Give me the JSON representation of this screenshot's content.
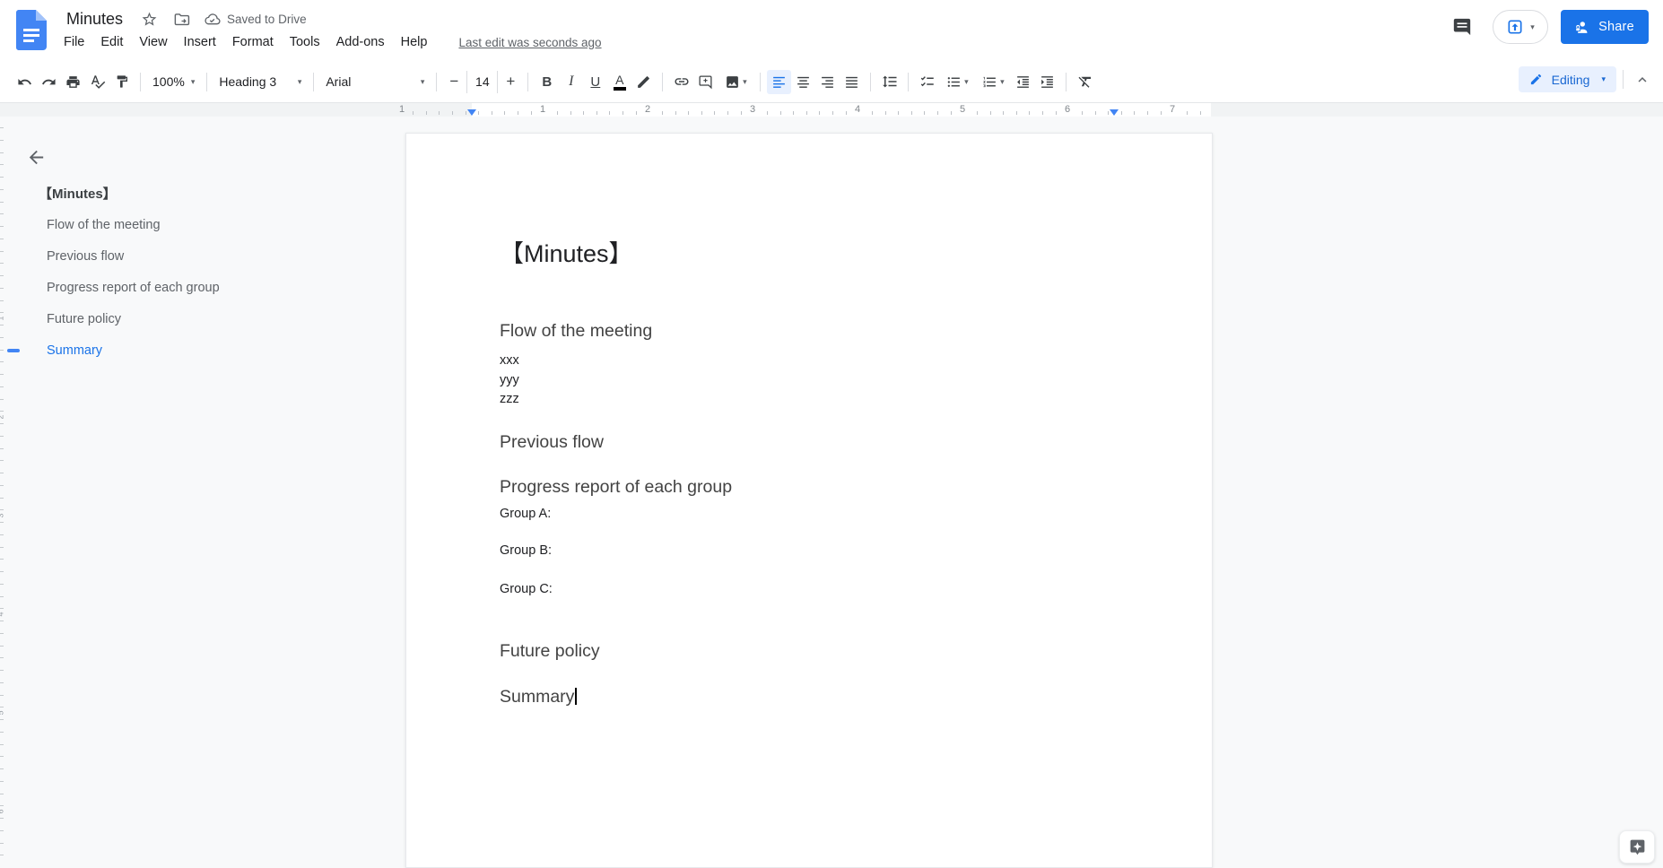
{
  "header": {
    "doc_title": "Minutes",
    "saved_status": "Saved to Drive",
    "last_edit": "Last edit was seconds ago",
    "menus": [
      "File",
      "Edit",
      "View",
      "Insert",
      "Format",
      "Tools",
      "Add-ons",
      "Help"
    ],
    "share_label": "Share"
  },
  "toolbar": {
    "zoom_value": "100%",
    "style_value": "Heading 3",
    "font_value": "Arial",
    "font_size_value": "14",
    "decrease_font_label": "−",
    "increase_font_label": "+",
    "bold_label": "B",
    "italic_label": "I",
    "underline_label": "U",
    "text_color_label": "A",
    "mode_label": "Editing"
  },
  "icons": {
    "dropdown": "▾"
  },
  "ruler": {
    "numbers": [
      "1",
      "1",
      "2",
      "3",
      "4",
      "5",
      "6",
      "7"
    ],
    "v_numbers": [
      "1",
      "2",
      "3",
      "4",
      "5",
      "6"
    ]
  },
  "outline": {
    "items": [
      {
        "label": "【Minutes】",
        "active": false
      },
      {
        "label": "Flow of the meeting",
        "active": false
      },
      {
        "label": "Previous flow",
        "active": false
      },
      {
        "label": "Progress report of each group",
        "active": false
      },
      {
        "label": "Future policy",
        "active": false
      },
      {
        "label": "Summary",
        "active": true
      }
    ]
  },
  "document": {
    "blocks": [
      {
        "type": "title",
        "text": "【Minutes】"
      },
      {
        "type": "heading",
        "text": "Flow of the meeting"
      },
      {
        "type": "body",
        "text": "xxx"
      },
      {
        "type": "body",
        "text": "yyy"
      },
      {
        "type": "body",
        "text": "zzz"
      },
      {
        "type": "heading",
        "text": "Previous flow"
      },
      {
        "type": "heading",
        "text": "Progress report of each group"
      },
      {
        "type": "body",
        "text": "Group A:"
      },
      {
        "type": "body",
        "text": "Group B:"
      },
      {
        "type": "body",
        "text": "Group C:"
      },
      {
        "type": "heading",
        "text": "Future policy"
      },
      {
        "type": "heading",
        "text": "Summary"
      }
    ]
  },
  "colors": {
    "accent": "#1a73e8",
    "share_button_bg": "#1a73e8",
    "editing_pill_bg": "#e8f0fe",
    "editing_pill_text": "#1967d2",
    "active_align_bg": "#e8f0fe",
    "heading_text": "#434343",
    "outline_active": "#1a73e8",
    "muted_text": "#5f6368",
    "ruler_marker": "#4285f4"
  }
}
